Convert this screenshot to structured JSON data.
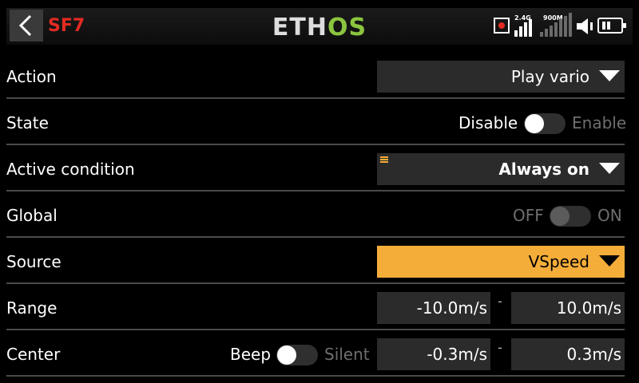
{
  "header": {
    "title": "SF7",
    "logo_left": "ETH",
    "logo_right": "OS",
    "band_24": "2.4G",
    "band_900": "900M"
  },
  "rows": {
    "action": {
      "label": "Action",
      "value": "Play vario"
    },
    "state": {
      "label": "State",
      "off_label": "Disable",
      "on_label": "Enable"
    },
    "active_condition": {
      "label": "Active condition",
      "value": "Always on"
    },
    "global": {
      "label": "Global",
      "off_label": "OFF",
      "on_label": "ON"
    },
    "source": {
      "label": "Source",
      "value": "VSpeed"
    },
    "range": {
      "label": "Range",
      "min": "-10.0m/s",
      "separator": "-",
      "max": "10.0m/s"
    },
    "center": {
      "label": "Center",
      "beep_label": "Beep",
      "silent_label": "Silent",
      "min": "-0.3m/s",
      "separator": "-",
      "max": "0.3m/s"
    }
  },
  "colors": {
    "title": "#e32b22",
    "logo_os": "#8bc53f",
    "highlight": "#f5ad3a",
    "field_bg": "#2b2b2b"
  },
  "icons": [
    "back-arrow-icon",
    "record-icon",
    "signal-bars-icon",
    "speaker-icon",
    "battery-icon",
    "dropdown-arrow-icon"
  ]
}
